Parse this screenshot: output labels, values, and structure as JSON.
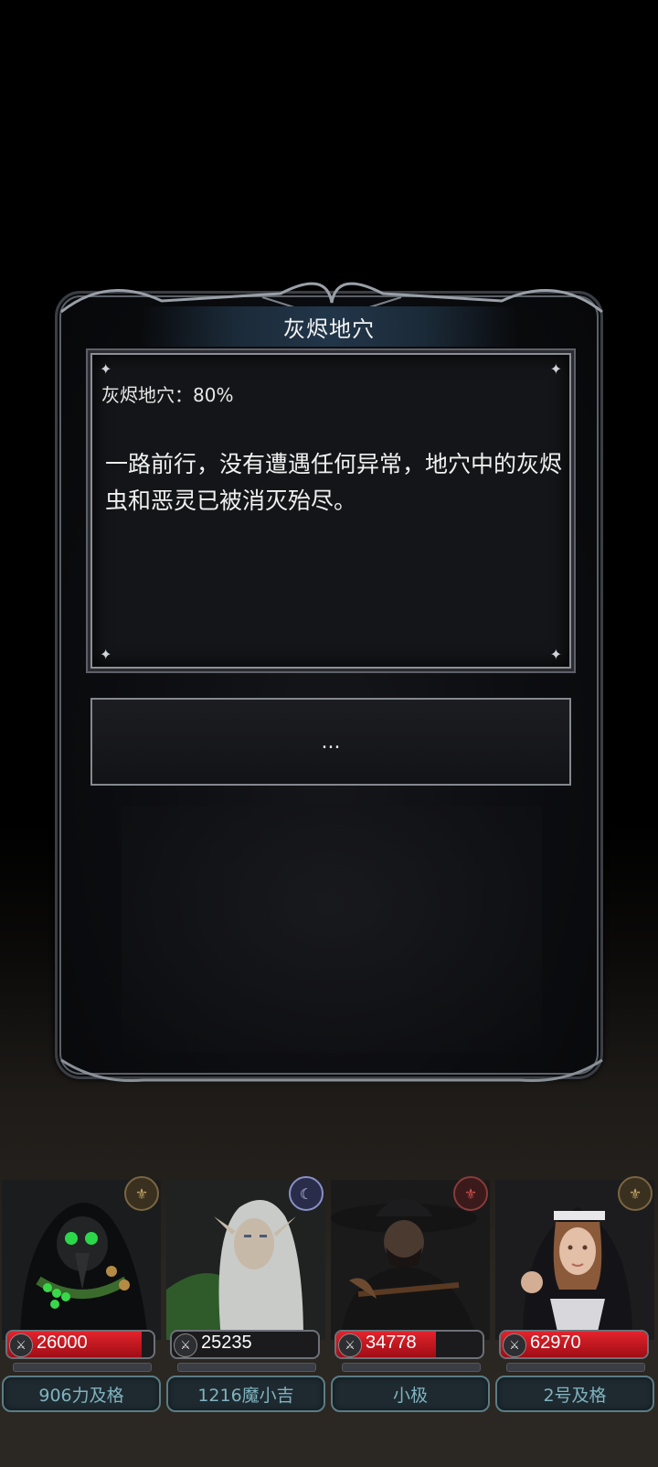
{
  "dialog": {
    "title": "灰烬地穴",
    "progress_text": "灰烬地穴：80%",
    "story_text": "一路前行，没有遭遇任何异常，地穴中的灰烬虫和恶灵已被消灭殆尽。",
    "continue_label": "..."
  },
  "party": [
    {
      "hp": "26000",
      "hp_fill": 0.92,
      "name": "906力及格",
      "badge_icon": "bronze-crest-icon"
    },
    {
      "hp": "25235",
      "hp_fill": 0.0,
      "name": "1216魔小吉",
      "badge_icon": "moon-orb-icon"
    },
    {
      "hp": "34778",
      "hp_fill": 0.68,
      "name": "小极",
      "badge_icon": "red-crest-icon"
    },
    {
      "hp": "62970",
      "hp_fill": 1.0,
      "name": "2号及格",
      "badge_icon": "bronze-crest-icon"
    }
  ]
}
